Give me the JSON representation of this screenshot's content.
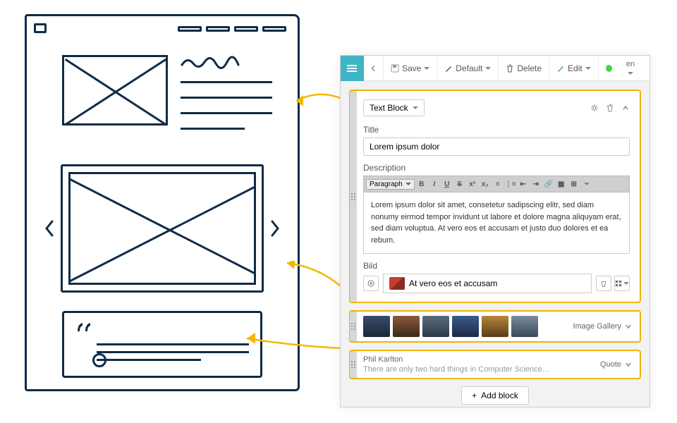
{
  "toolbar": {
    "save": "Save",
    "default": "Default",
    "delete": "Delete",
    "edit": "Edit",
    "language": "en"
  },
  "text_block": {
    "type_label": "Text Block",
    "title_label": "Title",
    "title_value": "Lorem ipsum dolor",
    "description_label": "Description",
    "rte_style": "Paragraph",
    "description_value": "Lorem ipsum dolor sit amet, consetetur sadipscing elitr, sed diam nonumy eirmod tempor invidunt ut labore et dolore magna aliquyam erat, sed diam voluptua. At vero eos et accusam et justo duo dolores et ea rebum.",
    "image_label": "Bild",
    "image_name": "At vero eos et accusam"
  },
  "gallery": {
    "label": "Image Gallery"
  },
  "quote": {
    "author": "Phil Karlton",
    "text": "There are only two hard things in Computer Science…",
    "label": "Quote"
  },
  "add_block": "Add block"
}
